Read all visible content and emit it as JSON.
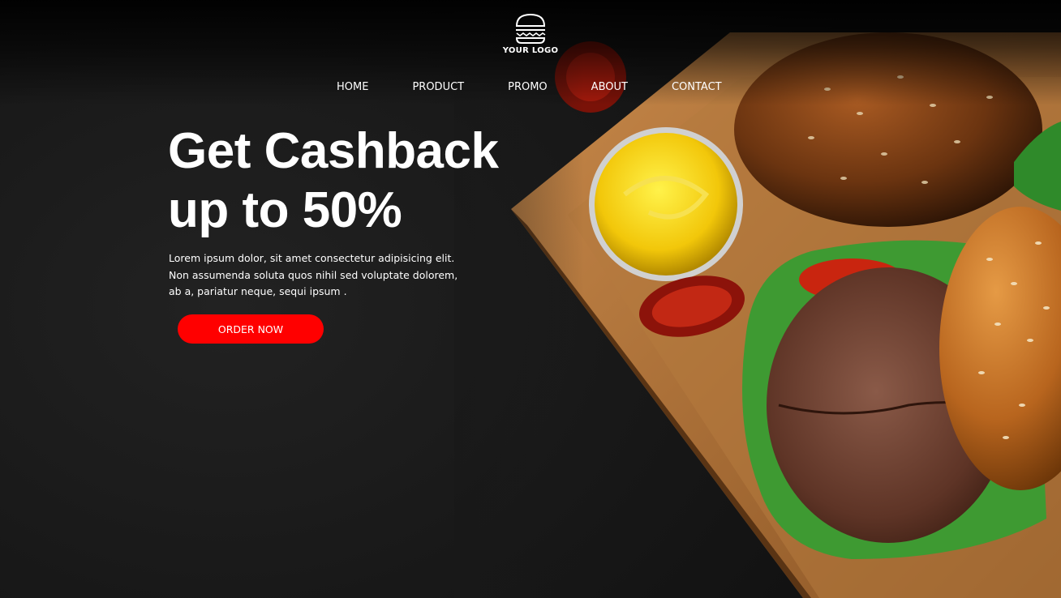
{
  "logo": {
    "text": "YOUR LOGO",
    "icon": "burger-icon"
  },
  "nav": {
    "items": [
      {
        "label": "HOME"
      },
      {
        "label": "PRODUCT"
      },
      {
        "label": "PROMO"
      },
      {
        "label": "ABOUT"
      },
      {
        "label": "CONTACT"
      }
    ]
  },
  "hero": {
    "headline_line1": "Get Cashback",
    "headline_line2": "up to 50%",
    "description": "Lorem ipsum dolor, sit amet consectetur adipisicing elit. Non assumenda soluta quos nihil sed voluptate dolorem, ab a, pariatur neque, sequi ipsum .",
    "cta_label": "ORDER NOW"
  },
  "colors": {
    "accent": "#ff0000",
    "background": "#1a1a1a",
    "text": "#ffffff"
  }
}
